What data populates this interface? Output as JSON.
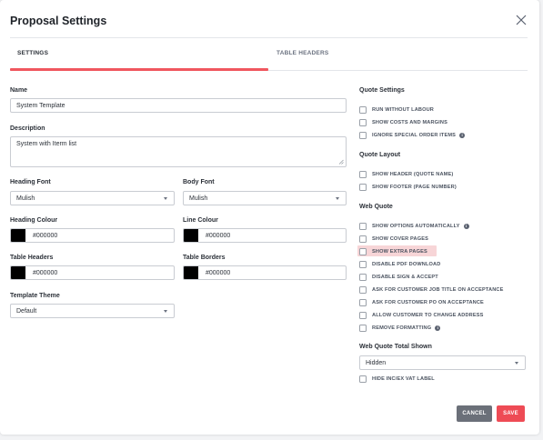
{
  "modal": {
    "title": "Proposal Settings"
  },
  "tabs": {
    "settings": "SETTINGS",
    "table_headers": "TABLE HEADERS"
  },
  "form": {
    "name_label": "Name",
    "name_value": "System Template",
    "description_label": "Description",
    "description_value": "System with Iterm list",
    "heading_font_label": "Heading Font",
    "heading_font_value": "Mulish",
    "body_font_label": "Body Font",
    "body_font_value": "Mulish",
    "heading_colour_label": "Heading Colour",
    "heading_colour_value": "#000000",
    "line_colour_label": "Line Colour",
    "line_colour_value": "#000000",
    "table_headers_label": "Table Headers",
    "table_headers_value": "#000000",
    "table_borders_label": "Table Borders",
    "table_borders_value": "#000000",
    "template_theme_label": "Template Theme",
    "template_theme_value": "Default"
  },
  "quote_settings": {
    "title": "Quote Settings",
    "items": [
      "RUN WITHOUT LABOUR",
      "SHOW COSTS AND MARGINS",
      "IGNORE SPECIAL ORDER ITEMS"
    ]
  },
  "quote_layout": {
    "title": "Quote Layout",
    "items": [
      "SHOW HEADER (QUOTE NAME)",
      "SHOW FOOTER (PAGE NUMBER)"
    ]
  },
  "web_quote": {
    "title": "Web Quote",
    "items": [
      "SHOW OPTIONS AUTOMATICALLY",
      "SHOW COVER PAGES",
      "SHOW EXTRA PAGES",
      "DISABLE PDF DOWNLOAD",
      "DISABLE SIGN & ACCEPT",
      "ASK FOR CUSTOMER JOB TITLE ON ACCEPTANCE",
      "ASK FOR CUSTOMER PO ON ACCEPTANCE",
      "ALLOW CUSTOMER TO CHANGE ADDRESS",
      "REMOVE FORMATTING"
    ]
  },
  "web_quote_total": {
    "title": "Web Quote Total Shown",
    "value": "Hidden",
    "checkbox": "HIDE INC/EX VAT LABEL"
  },
  "buttons": {
    "cancel": "CANCEL",
    "save": "SAVE"
  },
  "colors": {
    "accent": "#f0565e",
    "save": "#ee4b55",
    "cancel": "#6b7079",
    "highlight": "#f7d5d7",
    "swatch": "#000000"
  },
  "info_glyph": "i"
}
